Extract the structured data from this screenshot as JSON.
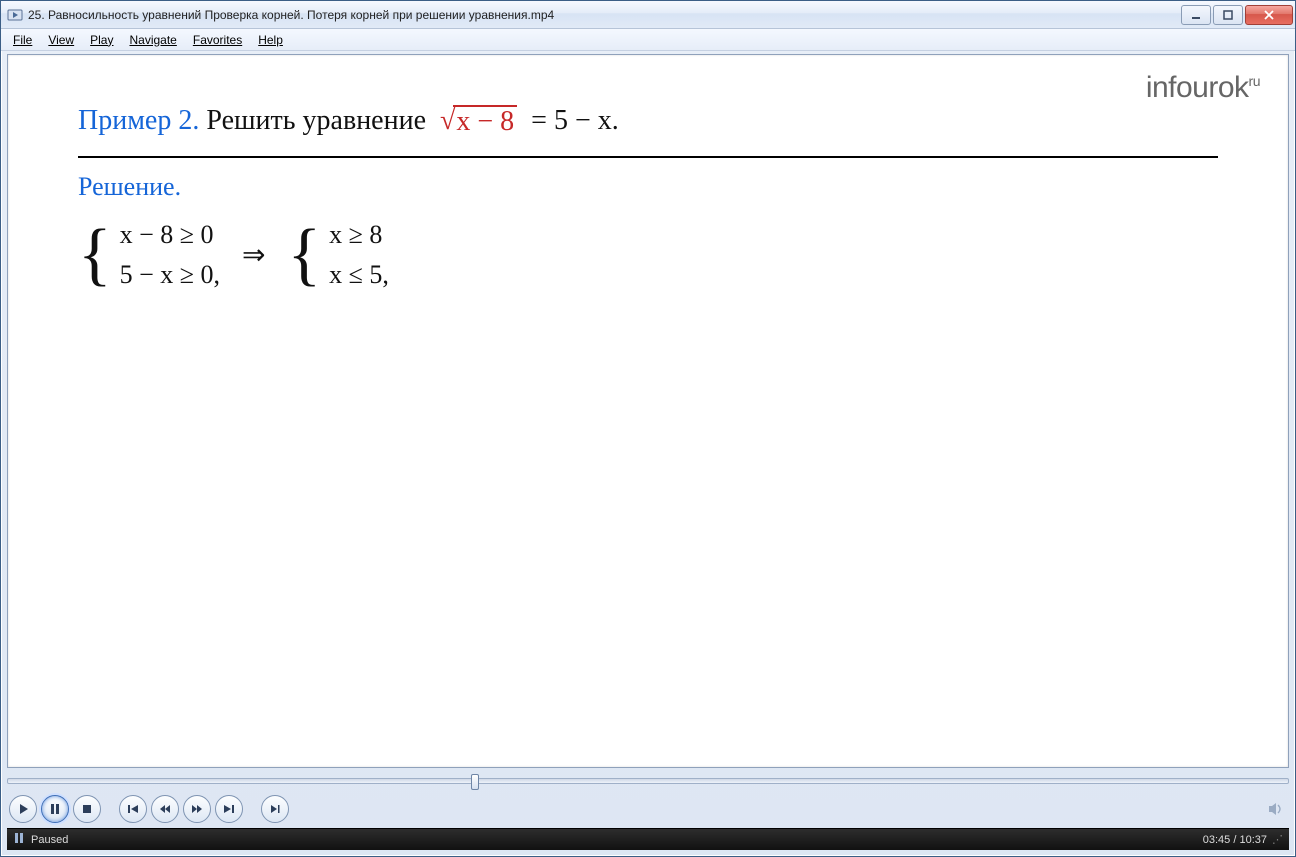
{
  "window": {
    "title": "25. Равносильность уравнений Проверка корней. Потеря корней при решении уравнения.mp4"
  },
  "menu": {
    "file": "File",
    "view": "View",
    "play": "Play",
    "navigate": "Navigate",
    "favorites": "Favorites",
    "help": "Help"
  },
  "brand": {
    "name": "infourok",
    "tld": "ru"
  },
  "slide": {
    "example_label": "Пример 2.",
    "task_text": "Решить уравнение",
    "equation_lhs_under_root": "x − 8",
    "equation_rhs": "= 5 − x.",
    "solution_label": "Решение.",
    "system1_line1": "x − 8 ≥ 0",
    "system1_line2": "5 − x ≥ 0,",
    "arrow": "⇒",
    "system2_line1": "x ≥ 8",
    "system2_line2": "x ≤ 5,"
  },
  "playback": {
    "progress_percent": 36.2,
    "current_time": "03:45",
    "total_time": "10:37",
    "status": "Paused"
  }
}
